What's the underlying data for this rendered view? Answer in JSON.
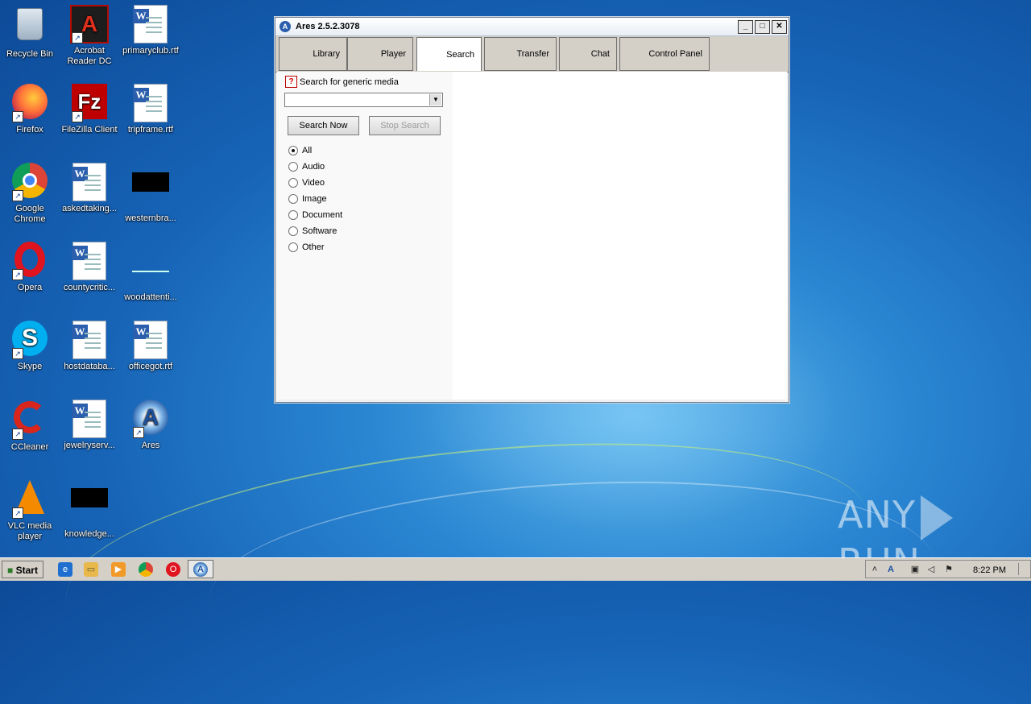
{
  "desktop": {
    "icons": [
      {
        "label": "Recycle Bin"
      },
      {
        "label": "Acrobat Reader DC"
      },
      {
        "label": "primaryclub.rtf"
      },
      {
        "label": "Firefox"
      },
      {
        "label": "FileZilla Client"
      },
      {
        "label": "tripframe.rtf"
      },
      {
        "label": "Google Chrome"
      },
      {
        "label": "askedtaking..."
      },
      {
        "label": "westernbra..."
      },
      {
        "label": "Opera"
      },
      {
        "label": "countycritic..."
      },
      {
        "label": "woodattenti..."
      },
      {
        "label": "Skype"
      },
      {
        "label": "hostdataba..."
      },
      {
        "label": "officegot.rtf"
      },
      {
        "label": "CCleaner"
      },
      {
        "label": "jewelryserv..."
      },
      {
        "label": "Ares"
      },
      {
        "label": "VLC media player"
      },
      {
        "label": "knowledge..."
      }
    ]
  },
  "window": {
    "title": "Ares 2.5.2.3078",
    "tabs": [
      {
        "label": "Library"
      },
      {
        "label": "Player"
      },
      {
        "label": "Search"
      },
      {
        "label": "Transfer"
      },
      {
        "label": "Chat"
      },
      {
        "label": "Control Panel"
      }
    ],
    "active_tab": "Search",
    "search": {
      "heading": "Search for generic media",
      "combo_value": "",
      "search_now": "Search Now",
      "stop_search": "Stop Search",
      "media_types": [
        {
          "label": "All",
          "checked": true
        },
        {
          "label": "Audio",
          "checked": false
        },
        {
          "label": "Video",
          "checked": false
        },
        {
          "label": "Image",
          "checked": false
        },
        {
          "label": "Document",
          "checked": false
        },
        {
          "label": "Software",
          "checked": false
        },
        {
          "label": "Other",
          "checked": false
        }
      ]
    }
  },
  "watermark": {
    "left": "ANY",
    "right": "RUN"
  },
  "taskbar": {
    "start": "Start",
    "clock": "8:22 PM"
  }
}
